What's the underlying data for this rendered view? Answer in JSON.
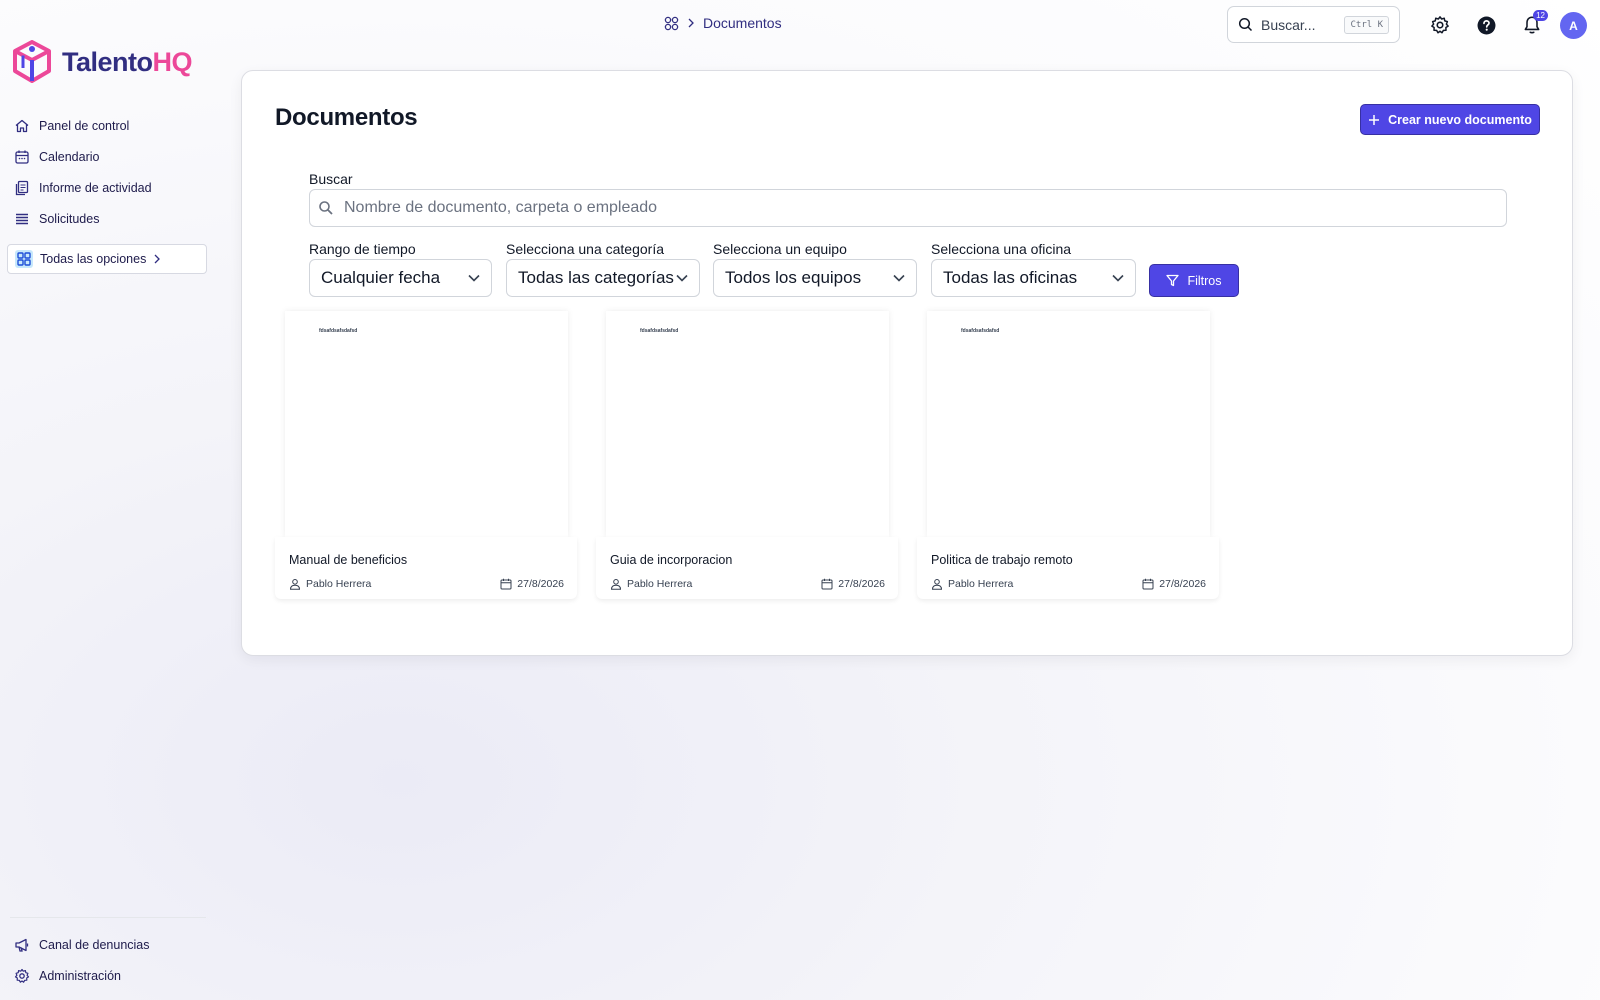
{
  "app": {
    "name_part1": "Talento",
    "name_part2": "HQ",
    "brand_colors": {
      "primary": "#4f46e5",
      "navy": "#312e81",
      "pink": "#ec4899"
    }
  },
  "sidebar": {
    "items": [
      {
        "label": "Panel de control",
        "icon": "home-icon"
      },
      {
        "label": "Calendario",
        "icon": "calendar-icon"
      },
      {
        "label": "Informe de actividad",
        "icon": "report-icon"
      },
      {
        "label": "Solicitudes",
        "icon": "stack-icon"
      }
    ],
    "all_options": {
      "label": "Todas las opciones",
      "icon": "apps-grid-icon"
    },
    "bottom_items": [
      {
        "label": "Canal de denuncias",
        "icon": "megaphone-icon"
      },
      {
        "label": "Administración",
        "icon": "gear-icon"
      }
    ]
  },
  "header": {
    "breadcrumb": {
      "current": "Documentos"
    },
    "search": {
      "placeholder": "Buscar...",
      "shortcut": "Ctrl K"
    },
    "notifications_count": "12",
    "avatar_initial": "A"
  },
  "main": {
    "title": "Documentos",
    "create_button": "Crear nuevo documento",
    "search": {
      "label": "Buscar",
      "placeholder": "Nombre de documento, carpeta o empleado"
    },
    "filters": [
      {
        "label": "Rango de tiempo",
        "value": "Cualquier fecha"
      },
      {
        "label": "Selecciona una categoría",
        "value": "Todas las categorías"
      },
      {
        "label": "Selecciona un equipo",
        "value": "Todos los equipos"
      },
      {
        "label": "Selecciona una oficina",
        "value": "Todas las oficinas"
      }
    ],
    "filter_button": "Filtros",
    "documents": [
      {
        "title": "Manual de beneficios",
        "author": "Pablo Herrera",
        "date": "27/8/2026",
        "preview_text": "fdsafdsafsdafsd"
      },
      {
        "title": "Guia de incorporacion",
        "author": "Pablo Herrera",
        "date": "27/8/2026",
        "preview_text": "fdsafdsafsdafsd"
      },
      {
        "title": "Politica de trabajo remoto",
        "author": "Pablo Herrera",
        "date": "27/8/2026",
        "preview_text": "fdsafdsafsdafsd"
      }
    ]
  }
}
